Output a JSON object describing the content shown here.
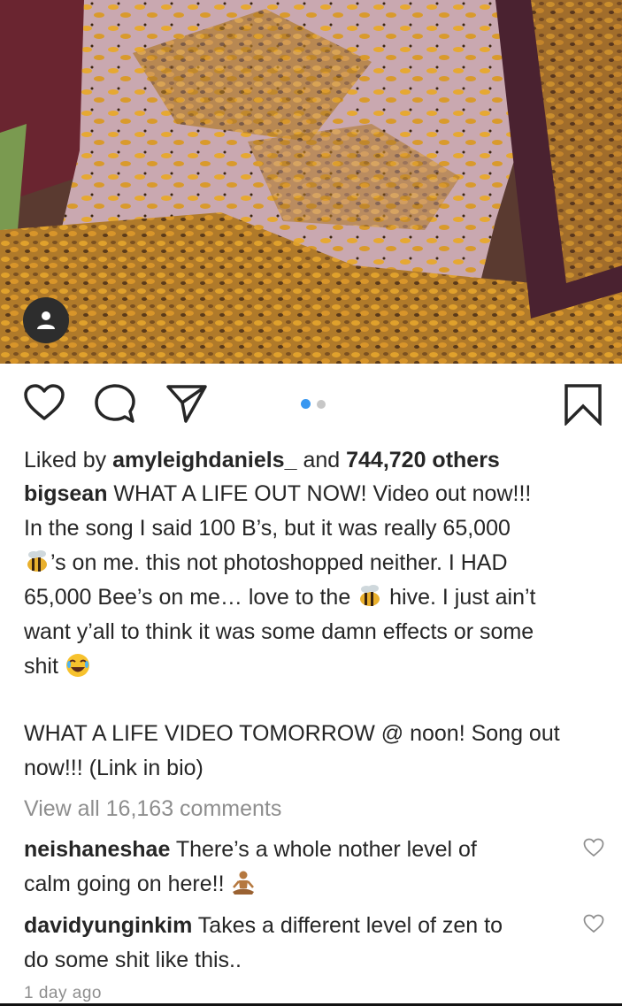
{
  "post": {
    "liked_prefix": "Liked by ",
    "liked_user": "amyleighdaniels_",
    "liked_middle": " and ",
    "liked_count": "744,720 others",
    "author": "bigsean",
    "caption_lines": [
      " WHAT A LIFE OUT NOW! Video out now!!!",
      "In the song I said 100 B’s, but it was really 65,000",
      "’s on me. this not photoshopped neither. I HAD",
      "65,000 Bee’s on me… love to the ",
      " hive. I just ain’t",
      "want y’all to think it was some damn effects or some",
      "shit "
    ],
    "caption_p2_line1": "WHAT A LIFE VIDEO TOMORROW @ noon! Song out",
    "caption_p2_line2": "now!!! (Link in bio)",
    "view_comments": "View all 16,163 comments",
    "time_ago": "1 day ago"
  },
  "comments": [
    {
      "user": "neishaneshae",
      "text_line1": " There’s a whole nother level of",
      "text_line2": "calm going on here!! "
    },
    {
      "user": "davidyunginkim",
      "text_line1": " Takes a different level of zen to",
      "text_line2": "do some shit like this.."
    }
  ],
  "icons": {
    "like": "heart-icon",
    "comment": "comment-icon",
    "share": "share-icon",
    "save": "bookmark-icon",
    "avatar": "user-icon",
    "emoji_bee": "bee-icon",
    "emoji_laugh": "laughing-icon",
    "emoji_meditate": "meditation-icon"
  },
  "colors": {
    "text": "#262626",
    "muted": "#8e8e8e",
    "dot_active": "#3897f0",
    "dot_inactive": "#c7c7c7"
  },
  "carousel": {
    "total": 2,
    "active": 1
  }
}
